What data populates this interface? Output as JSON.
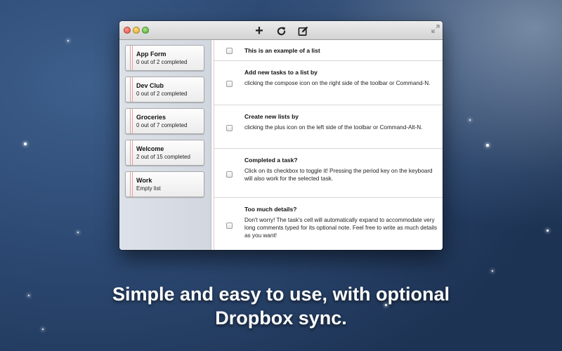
{
  "toolbar": {
    "add_icon_glyph": "+",
    "icons": [
      "plus-icon",
      "refresh-icon",
      "compose-icon",
      "fullscreen-icon"
    ]
  },
  "lists": [
    {
      "name": "App Form",
      "status": "0 out of 2 completed"
    },
    {
      "name": "Dev Club",
      "status": "0 out of 2 completed"
    },
    {
      "name": "Groceries",
      "status": "0 out of 7 completed"
    },
    {
      "name": "Welcome",
      "status": "2 out of 15 completed"
    },
    {
      "name": "Work",
      "status": "Empty list"
    }
  ],
  "tasks": [
    {
      "title": "This is an example of a list",
      "body": ""
    },
    {
      "title": "Add new tasks to a list by",
      "body": "clicking the compose icon on the right side of the toolbar or Command-N."
    },
    {
      "title": "Create new lists by",
      "body": "clicking the plus icon on the left side of the toolbar or Command-Alt-N."
    },
    {
      "title": "Completed a task?",
      "body": "Click on its checkbox to toggle it! Pressing the period key on the keyboard will also work for the selected task."
    },
    {
      "title": "Too much details?",
      "body": "Don't worry! The task's cell will automatically expand to accommodate very long comments typed for its optional note. Feel free to write as much details as you want!"
    }
  ],
  "caption": {
    "line1": "Simple and easy to use, with optional",
    "line2": "Dropbox sync."
  },
  "colors": {
    "sidebar": "#d2d7df",
    "margin_line": "#e3a0a0",
    "wallpaper": "#2d4a74"
  }
}
